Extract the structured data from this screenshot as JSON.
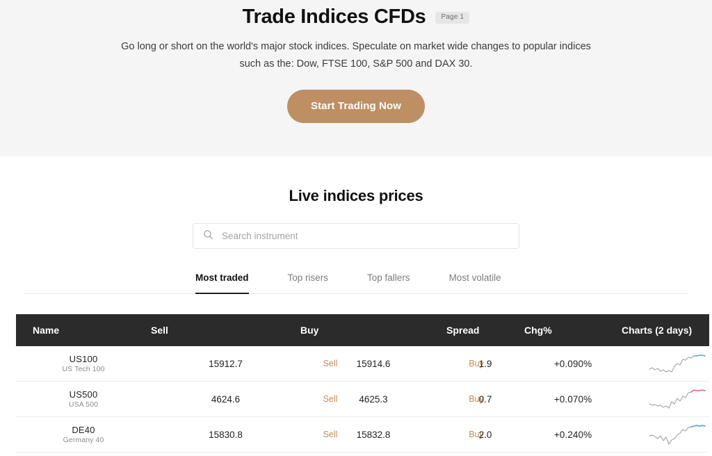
{
  "hero": {
    "title": "Trade Indices CFDs",
    "badge": "Page 1",
    "subtitle_line1": "Go long or short on the world's major stock indices. Speculate on market wide changes to popular",
    "subtitle_line2": "indices such as the: Dow, FTSE 100, S&P 500 and DAX 30.",
    "cta_label": "Start Trading Now",
    "cta_color": "#bd8f63",
    "background_color": "#f5f5f5"
  },
  "prices": {
    "section_title": "Live indices prices",
    "search": {
      "icon": "search-icon",
      "placeholder": "Search instrument",
      "value": ""
    },
    "tabs": [
      {
        "label": "Most traded",
        "active": true
      },
      {
        "label": "Top risers",
        "active": false
      },
      {
        "label": "Top fallers",
        "active": false
      },
      {
        "label": "Most volatile",
        "active": false
      }
    ],
    "table": {
      "headers": {
        "name": "Name",
        "sell": "Sell",
        "buy": "Buy",
        "spread": "Spread",
        "chg": "Chg%",
        "chart": "Charts (2 days)"
      },
      "sell_button_label": "Sell",
      "buy_button_label": "Buy",
      "rows": [
        {
          "symbol": "US100",
          "description": "US Tech 100",
          "sell": "15912.7",
          "buy": "15914.6",
          "spread": "1.9",
          "chg": "+0.090%",
          "chg_color": "#6aa8c9",
          "spark_end_color": "#5fa8c4"
        },
        {
          "symbol": "US500",
          "description": "USA 500",
          "sell": "4624.6",
          "buy": "4625.3",
          "spread": "0.7",
          "chg": "+0.070%",
          "chg_color": "#6aa8c9",
          "spark_end_color": "#e8607a"
        },
        {
          "symbol": "DE40",
          "description": "Germany 40",
          "sell": "15830.8",
          "buy": "15832.8",
          "spread": "2.0",
          "chg": "+0.240%",
          "chg_color": "#6aa8c9",
          "spark_end_color": "#5fa8c4"
        }
      ]
    }
  }
}
